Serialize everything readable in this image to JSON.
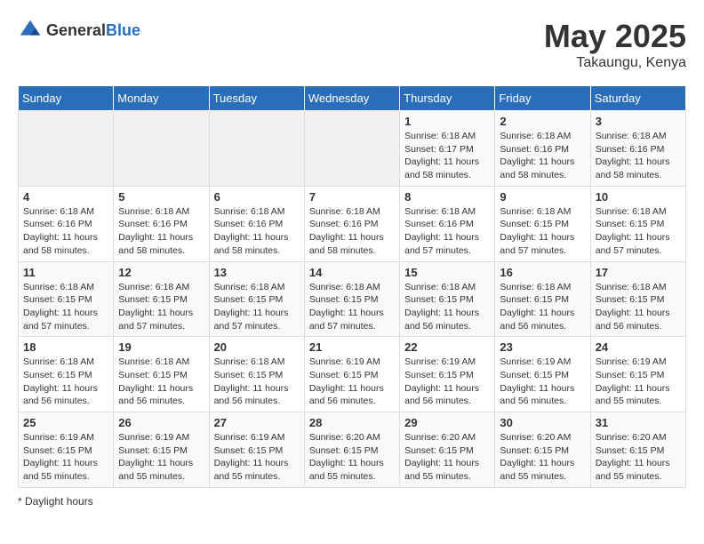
{
  "header": {
    "logo_general": "General",
    "logo_blue": "Blue",
    "month": "May 2025",
    "location": "Takaungu, Kenya"
  },
  "days_of_week": [
    "Sunday",
    "Monday",
    "Tuesday",
    "Wednesday",
    "Thursday",
    "Friday",
    "Saturday"
  ],
  "footer": {
    "daylight_label": "Daylight hours"
  },
  "weeks": [
    [
      {
        "day": "",
        "detail": ""
      },
      {
        "day": "",
        "detail": ""
      },
      {
        "day": "",
        "detail": ""
      },
      {
        "day": "",
        "detail": ""
      },
      {
        "day": "1",
        "detail": "Sunrise: 6:18 AM\nSunset: 6:17 PM\nDaylight: 11 hours\nand 58 minutes."
      },
      {
        "day": "2",
        "detail": "Sunrise: 6:18 AM\nSunset: 6:16 PM\nDaylight: 11 hours\nand 58 minutes."
      },
      {
        "day": "3",
        "detail": "Sunrise: 6:18 AM\nSunset: 6:16 PM\nDaylight: 11 hours\nand 58 minutes."
      }
    ],
    [
      {
        "day": "4",
        "detail": "Sunrise: 6:18 AM\nSunset: 6:16 PM\nDaylight: 11 hours\nand 58 minutes."
      },
      {
        "day": "5",
        "detail": "Sunrise: 6:18 AM\nSunset: 6:16 PM\nDaylight: 11 hours\nand 58 minutes."
      },
      {
        "day": "6",
        "detail": "Sunrise: 6:18 AM\nSunset: 6:16 PM\nDaylight: 11 hours\nand 58 minutes."
      },
      {
        "day": "7",
        "detail": "Sunrise: 6:18 AM\nSunset: 6:16 PM\nDaylight: 11 hours\nand 58 minutes."
      },
      {
        "day": "8",
        "detail": "Sunrise: 6:18 AM\nSunset: 6:16 PM\nDaylight: 11 hours\nand 57 minutes."
      },
      {
        "day": "9",
        "detail": "Sunrise: 6:18 AM\nSunset: 6:15 PM\nDaylight: 11 hours\nand 57 minutes."
      },
      {
        "day": "10",
        "detail": "Sunrise: 6:18 AM\nSunset: 6:15 PM\nDaylight: 11 hours\nand 57 minutes."
      }
    ],
    [
      {
        "day": "11",
        "detail": "Sunrise: 6:18 AM\nSunset: 6:15 PM\nDaylight: 11 hours\nand 57 minutes."
      },
      {
        "day": "12",
        "detail": "Sunrise: 6:18 AM\nSunset: 6:15 PM\nDaylight: 11 hours\nand 57 minutes."
      },
      {
        "day": "13",
        "detail": "Sunrise: 6:18 AM\nSunset: 6:15 PM\nDaylight: 11 hours\nand 57 minutes."
      },
      {
        "day": "14",
        "detail": "Sunrise: 6:18 AM\nSunset: 6:15 PM\nDaylight: 11 hours\nand 57 minutes."
      },
      {
        "day": "15",
        "detail": "Sunrise: 6:18 AM\nSunset: 6:15 PM\nDaylight: 11 hours\nand 56 minutes."
      },
      {
        "day": "16",
        "detail": "Sunrise: 6:18 AM\nSunset: 6:15 PM\nDaylight: 11 hours\nand 56 minutes."
      },
      {
        "day": "17",
        "detail": "Sunrise: 6:18 AM\nSunset: 6:15 PM\nDaylight: 11 hours\nand 56 minutes."
      }
    ],
    [
      {
        "day": "18",
        "detail": "Sunrise: 6:18 AM\nSunset: 6:15 PM\nDaylight: 11 hours\nand 56 minutes."
      },
      {
        "day": "19",
        "detail": "Sunrise: 6:18 AM\nSunset: 6:15 PM\nDaylight: 11 hours\nand 56 minutes."
      },
      {
        "day": "20",
        "detail": "Sunrise: 6:18 AM\nSunset: 6:15 PM\nDaylight: 11 hours\nand 56 minutes."
      },
      {
        "day": "21",
        "detail": "Sunrise: 6:19 AM\nSunset: 6:15 PM\nDaylight: 11 hours\nand 56 minutes."
      },
      {
        "day": "22",
        "detail": "Sunrise: 6:19 AM\nSunset: 6:15 PM\nDaylight: 11 hours\nand 56 minutes."
      },
      {
        "day": "23",
        "detail": "Sunrise: 6:19 AM\nSunset: 6:15 PM\nDaylight: 11 hours\nand 56 minutes."
      },
      {
        "day": "24",
        "detail": "Sunrise: 6:19 AM\nSunset: 6:15 PM\nDaylight: 11 hours\nand 55 minutes."
      }
    ],
    [
      {
        "day": "25",
        "detail": "Sunrise: 6:19 AM\nSunset: 6:15 PM\nDaylight: 11 hours\nand 55 minutes."
      },
      {
        "day": "26",
        "detail": "Sunrise: 6:19 AM\nSunset: 6:15 PM\nDaylight: 11 hours\nand 55 minutes."
      },
      {
        "day": "27",
        "detail": "Sunrise: 6:19 AM\nSunset: 6:15 PM\nDaylight: 11 hours\nand 55 minutes."
      },
      {
        "day": "28",
        "detail": "Sunrise: 6:20 AM\nSunset: 6:15 PM\nDaylight: 11 hours\nand 55 minutes."
      },
      {
        "day": "29",
        "detail": "Sunrise: 6:20 AM\nSunset: 6:15 PM\nDaylight: 11 hours\nand 55 minutes."
      },
      {
        "day": "30",
        "detail": "Sunrise: 6:20 AM\nSunset: 6:15 PM\nDaylight: 11 hours\nand 55 minutes."
      },
      {
        "day": "31",
        "detail": "Sunrise: 6:20 AM\nSunset: 6:15 PM\nDaylight: 11 hours\nand 55 minutes."
      }
    ]
  ]
}
